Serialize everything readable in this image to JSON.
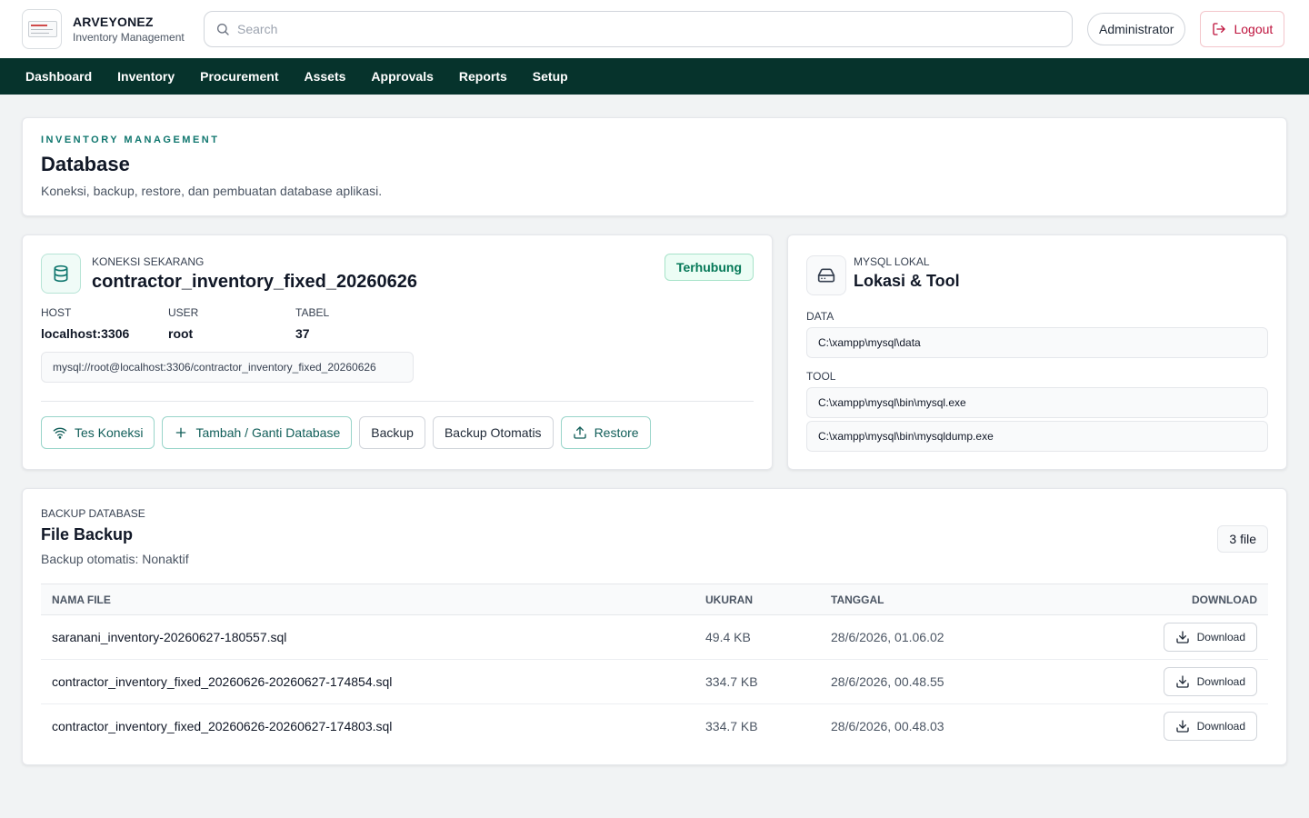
{
  "app": {
    "name": "ARVEYONEZ",
    "subtitle": "Inventory Management"
  },
  "search": {
    "placeholder": "Search"
  },
  "user": {
    "name": "Administrator",
    "logout_label": "Logout"
  },
  "nav": [
    "Dashboard",
    "Inventory",
    "Procurement",
    "Assets",
    "Approvals",
    "Reports",
    "Setup"
  ],
  "page": {
    "eyebrow": "INVENTORY MANAGEMENT",
    "title": "Database",
    "description": "Koneksi, backup, restore, dan pembuatan database aplikasi."
  },
  "connection": {
    "label": "KONEKSI SEKARANG",
    "name": "contractor_inventory_fixed_20260626",
    "status": "Terhubung",
    "host_label": "HOST",
    "host": "localhost:3306",
    "user_label": "USER",
    "user": "root",
    "table_label": "TABEL",
    "tables": "37",
    "dsn": "mysql://root@localhost:3306/contractor_inventory_fixed_20260626",
    "actions": {
      "test": "Tes Koneksi",
      "add": "Tambah / Ganti Database",
      "backup": "Backup",
      "auto_backup": "Backup Otomatis",
      "restore": "Restore"
    }
  },
  "mysql": {
    "label": "MYSQL LOKAL",
    "title": "Lokasi & Tool",
    "data_label": "DATA",
    "data_path": "C:\\xampp\\mysql\\data",
    "tool_label": "TOOL",
    "tools": [
      "C:\\xampp\\mysql\\bin\\mysql.exe",
      "C:\\xampp\\mysql\\bin\\mysqldump.exe"
    ]
  },
  "backup": {
    "label": "BACKUP DATABASE",
    "title": "File Backup",
    "status": "Backup otomatis: Nonaktif",
    "count": "3 file",
    "columns": {
      "name": "NAMA FILE",
      "size": "UKURAN",
      "date": "TANGGAL",
      "download": "DOWNLOAD"
    },
    "download_label": "Download",
    "files": [
      {
        "name": "saranani_inventory-20260627-180557.sql",
        "size": "49.4 KB",
        "date": "28/6/2026, 01.06.02"
      },
      {
        "name": "contractor_inventory_fixed_20260626-20260627-174854.sql",
        "size": "334.7 KB",
        "date": "28/6/2026, 00.48.55"
      },
      {
        "name": "contractor_inventory_fixed_20260626-20260627-174803.sql",
        "size": "334.7 KB",
        "date": "28/6/2026, 00.48.03"
      }
    ]
  },
  "icons": {
    "database": "database-icon",
    "search": "search-icon",
    "logout": "logout-icon",
    "wifi": "wifi-icon",
    "plus": "plus-icon",
    "upload": "upload-icon",
    "drive": "hard-drive-icon",
    "download": "download-icon"
  },
  "colors": {
    "nav_bg": "#06332c",
    "accent": "#0f766e",
    "success": "#047857",
    "danger": "#be123c"
  }
}
